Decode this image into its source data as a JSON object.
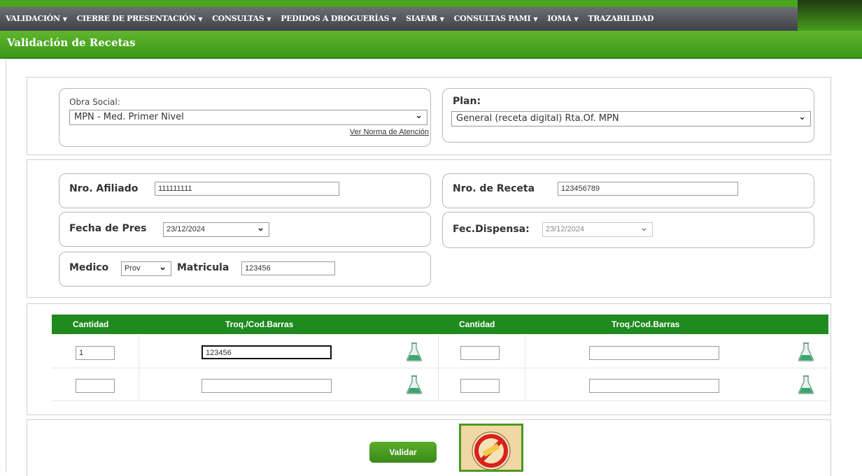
{
  "nav": {
    "items": [
      {
        "label": "VALIDACIÓN",
        "has_menu": true
      },
      {
        "label": "CIERRE DE PRESENTACIÓN",
        "has_menu": true
      },
      {
        "label": "CONSULTAS",
        "has_menu": true
      },
      {
        "label": "PEDIDOS A DROGUERÍAS",
        "has_menu": true
      },
      {
        "label": "SIAFAR",
        "has_menu": true
      },
      {
        "label": "CONSULTAS PAMI",
        "has_menu": true
      },
      {
        "label": "IOMA",
        "has_menu": true
      },
      {
        "label": "TRAZABILIDAD",
        "has_menu": false
      }
    ]
  },
  "page": {
    "title": "Validación de Recetas"
  },
  "obra_social": {
    "label": "Obra Social:",
    "value": "MPN - Med. Primer Nivel",
    "norma_link": "Ver Norma de Atención"
  },
  "plan": {
    "label": "Plan:",
    "value": "General (receta digital) Rta.Of. MPN"
  },
  "afiliado": {
    "label": "Nro. Afiliado",
    "value": "111111111"
  },
  "receta": {
    "label": "Nro. de Receta",
    "value": "123456789"
  },
  "fecha_pres": {
    "label": "Fecha de Pres",
    "value": "23/12/2024"
  },
  "fec_dispensa": {
    "label": "Fec.Dispensa:",
    "value": "23/12/2024"
  },
  "medico": {
    "label": "Medico",
    "tipo": "Prov"
  },
  "matricula": {
    "label": "Matricula",
    "value": "123456"
  },
  "table": {
    "headers": [
      "Cantidad",
      "Troq./Cod.Barras",
      "Cantidad",
      "Troq./Cod.Barras"
    ],
    "rows": [
      {
        "cantidad1": "1",
        "codigo1": "123456",
        "cantidad2": "",
        "codigo2": ""
      },
      {
        "cantidad1": "",
        "codigo1": "",
        "cantidad2": "",
        "codigo2": ""
      }
    ]
  },
  "actions": {
    "validar_label": "Validar"
  },
  "icons": {
    "menu_caret": "chevron-down-icon",
    "select_chevron": "chevron-down-icon",
    "lookup": "flask-icon",
    "stamp": "stamp-icon"
  },
  "colors": {
    "primary_green": "#3c9a16",
    "table_header": "#1f8a1f",
    "nav_bar": "#55595e"
  }
}
